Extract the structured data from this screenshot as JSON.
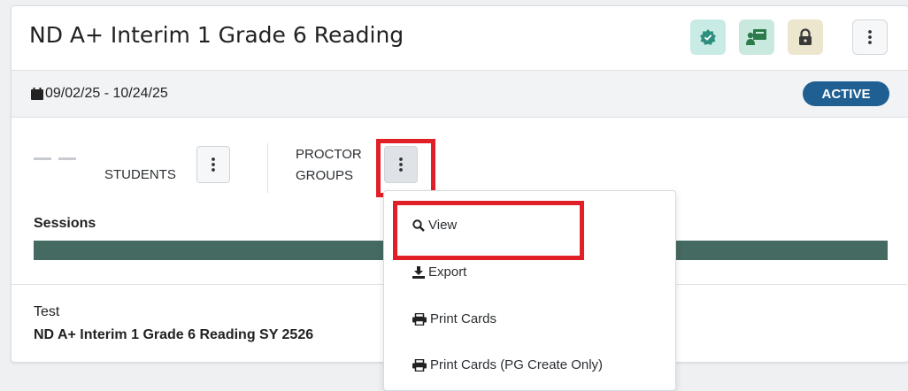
{
  "header": {
    "title": "ND A+ Interim 1 Grade 6 Reading",
    "icons": [
      "verified-badge-icon",
      "classroom-icon",
      "lock-icon",
      "more-vertical-icon"
    ]
  },
  "date_row": {
    "date_range": "09/02/25 - 10/24/25",
    "status": "ACTIVE"
  },
  "stats": {
    "students_value": "— —",
    "students_label": "STUDENTS",
    "proctor_label_1": "PROCTOR",
    "proctor_label_2": "GROUPS"
  },
  "sessions": {
    "label": "Sessions"
  },
  "test": {
    "label": "Test",
    "name": "ND A+ Interim 1 Grade 6 Reading SY 2526"
  },
  "menu": {
    "items": [
      {
        "label": "View",
        "icon": "search-icon"
      },
      {
        "label": "Export",
        "icon": "download-icon"
      },
      {
        "label": "Print Cards",
        "icon": "print-icon"
      },
      {
        "label": "Print Cards (PG Create Only)",
        "icon": "print-icon"
      }
    ]
  },
  "colors": {
    "status_badge": "#1f5f92",
    "sessions_bar": "#456a61",
    "highlight": "#e11f26"
  }
}
